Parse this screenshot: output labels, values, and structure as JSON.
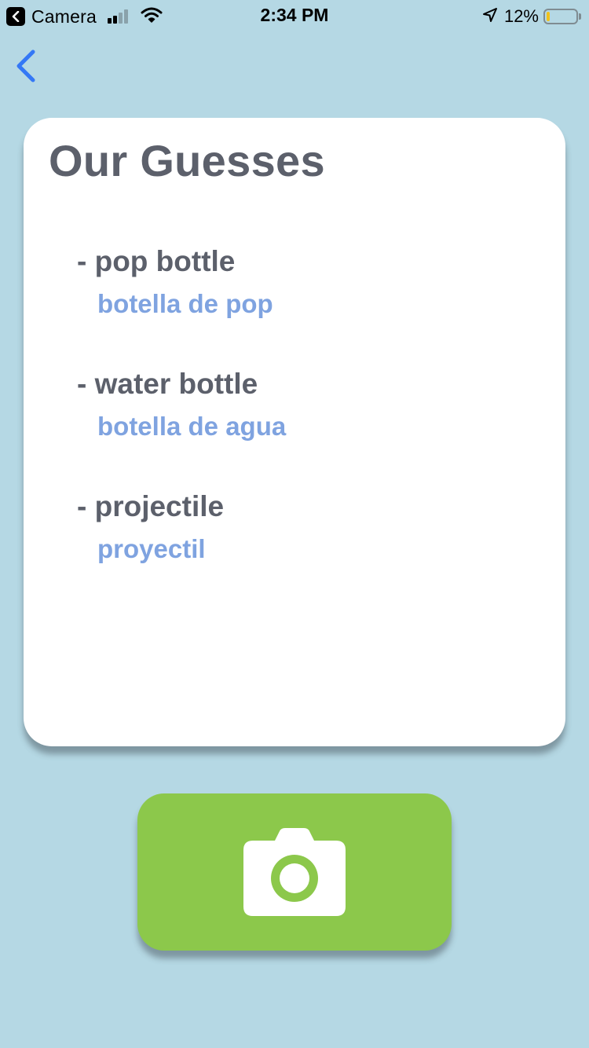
{
  "status_bar": {
    "back_app_label": "Camera",
    "time": "2:34 PM",
    "battery_percent_label": "12%",
    "battery_level": 0.12,
    "signal_bars_active": 2,
    "signal_bars_total": 4
  },
  "nav": {
    "back_icon": "chevron-left-icon"
  },
  "card": {
    "title": "Our Guesses",
    "guesses": [
      {
        "english": "- pop bottle",
        "spanish": "botella de pop"
      },
      {
        "english": "- water bottle",
        "spanish": "botella de agua"
      },
      {
        "english": "- projectile",
        "spanish": "proyectil"
      }
    ]
  },
  "camera_button": {
    "icon": "camera-icon"
  },
  "colors": {
    "background": "#b5d8e4",
    "card": "#ffffff",
    "title_text": "#5c606b",
    "translation_text": "#7fa3e0",
    "accent_green": "#8cc84b",
    "back_chevron": "#3478f6",
    "battery_fill": "#f1c21b"
  }
}
